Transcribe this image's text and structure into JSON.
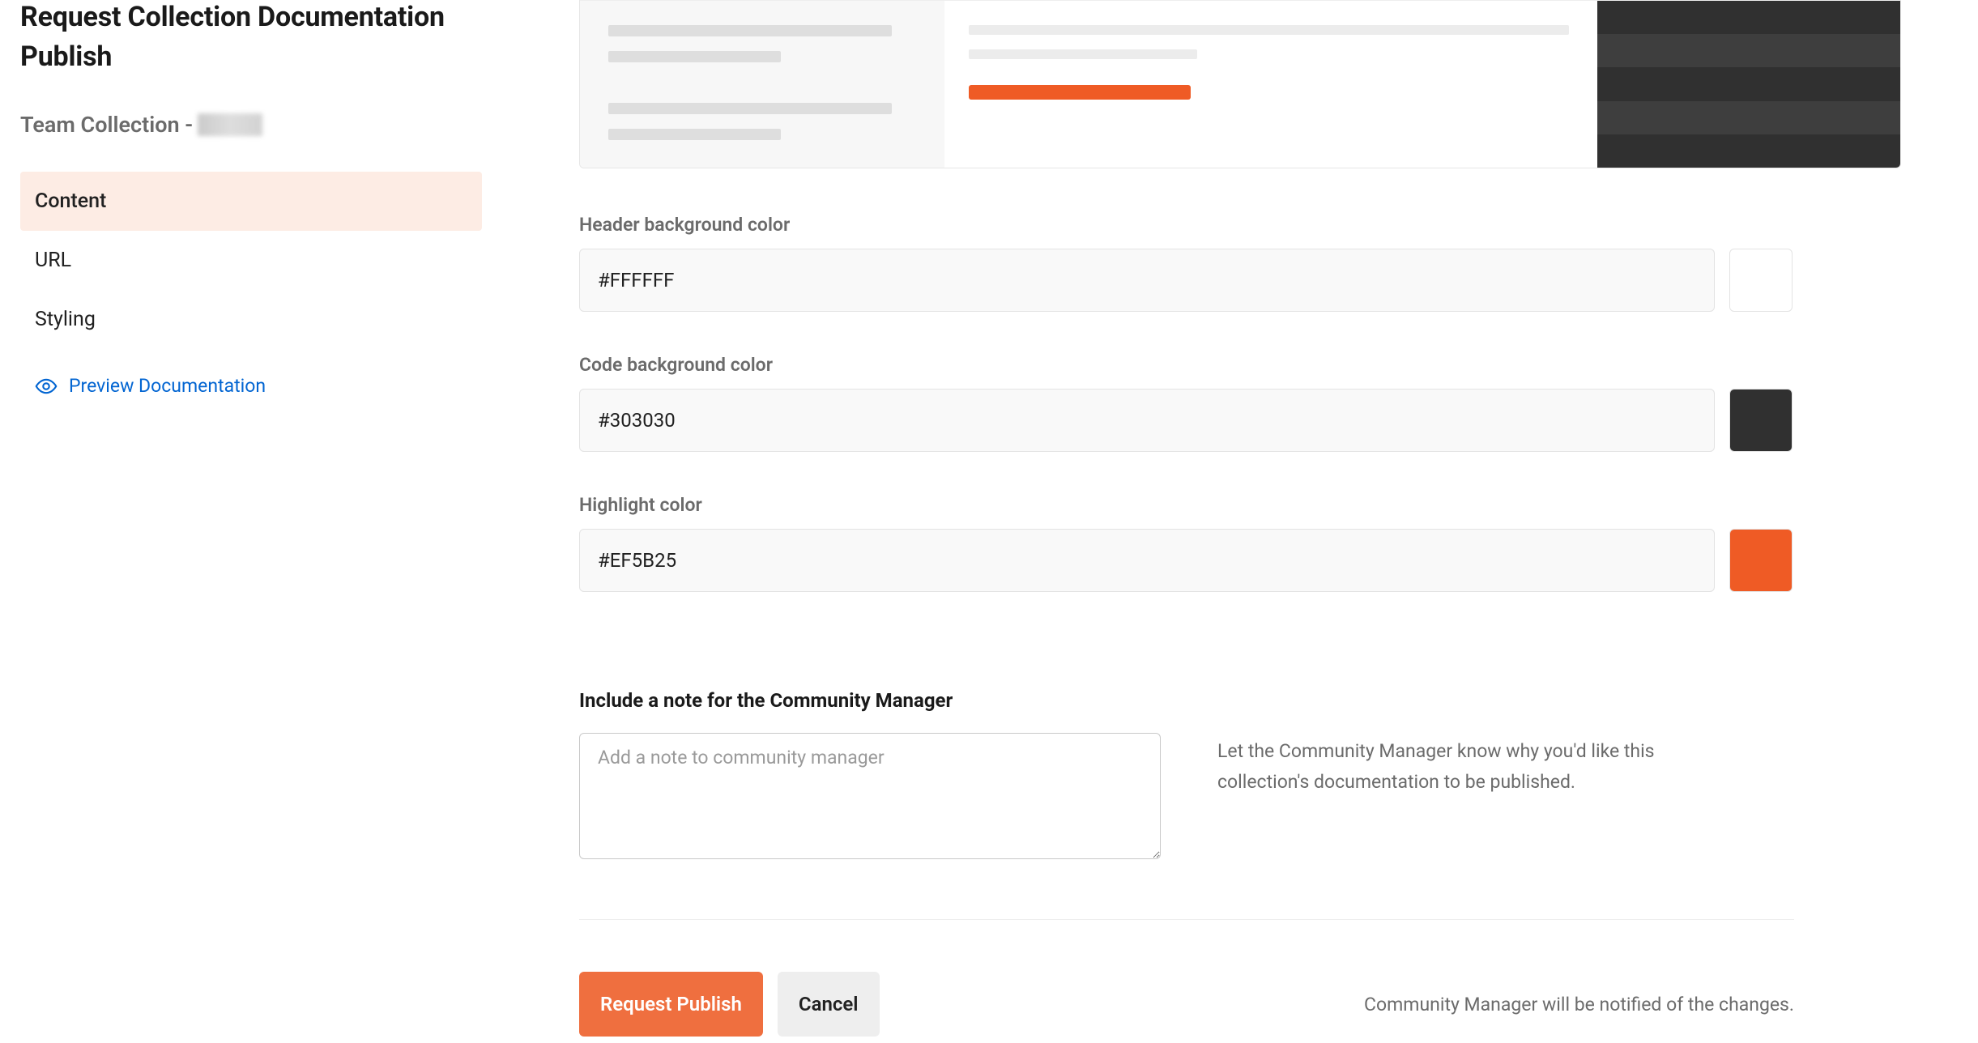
{
  "sidebar": {
    "title": "Request Collection Documentation Publish",
    "subtitle_prefix": "Team Collection - ",
    "nav": [
      {
        "label": "Content",
        "active": true
      },
      {
        "label": "URL",
        "active": false
      },
      {
        "label": "Styling",
        "active": false
      }
    ],
    "preview_link": "Preview Documentation"
  },
  "styling": {
    "header_bg": {
      "label": "Header background color",
      "value": "#FFFFFF",
      "swatch": "#FFFFFF"
    },
    "code_bg": {
      "label": "Code background color",
      "value": "#303030",
      "swatch": "#303030"
    },
    "highlight": {
      "label": "Highlight color",
      "value": "#EF5B25",
      "swatch": "#EF5B25"
    }
  },
  "note": {
    "heading": "Include a note for the Community Manager",
    "placeholder": "Add a note to community manager",
    "help": "Let the Community Manager know why you'd like this collection's documentation to be published."
  },
  "actions": {
    "primary": "Request Publish",
    "secondary": "Cancel",
    "footer_note": "Community Manager will be notified of the changes."
  }
}
